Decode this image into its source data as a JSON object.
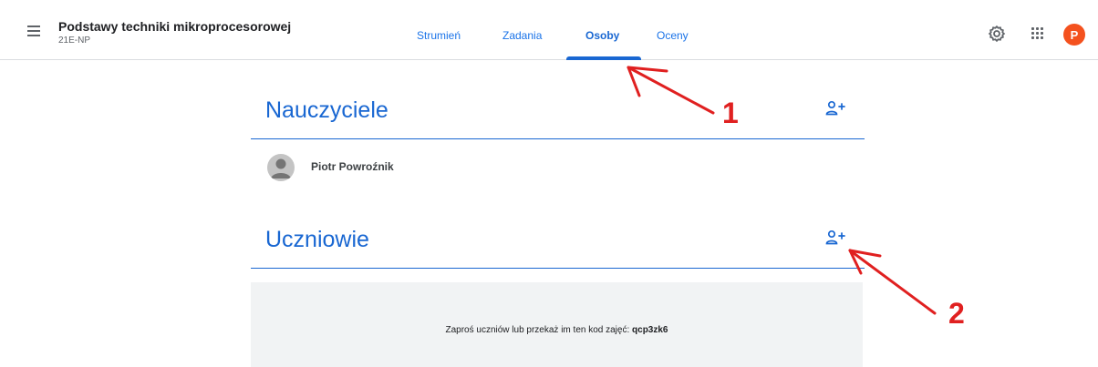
{
  "header": {
    "class_title": "Podstawy techniki mikroprocesorowej",
    "class_section": "21E-NP",
    "avatar_letter": "P",
    "avatar_color": "#f4511e",
    "icons": [
      "menu-icon",
      "settings-icon",
      "apps-icon"
    ]
  },
  "tabs": [
    {
      "label": "Strumień",
      "active": false
    },
    {
      "label": "Zadania",
      "active": false
    },
    {
      "label": "Osoby",
      "active": true
    },
    {
      "label": "Oceny",
      "active": false
    }
  ],
  "teachers": {
    "heading": "Nauczyciele",
    "members": [
      {
        "name": "Piotr Powroźnik"
      }
    ]
  },
  "students": {
    "heading": "Uczniowie",
    "invite": {
      "text": "Zaproś uczniów lub przekaż im ten kod zajęć:",
      "code": "qcp3zk6"
    }
  },
  "annotations": [
    "1",
    "2"
  ],
  "colors": {
    "accent": "#1967d2",
    "tab": "#1a73e8",
    "annotation": "#e02020",
    "invite_bg": "#f1f3f4"
  }
}
